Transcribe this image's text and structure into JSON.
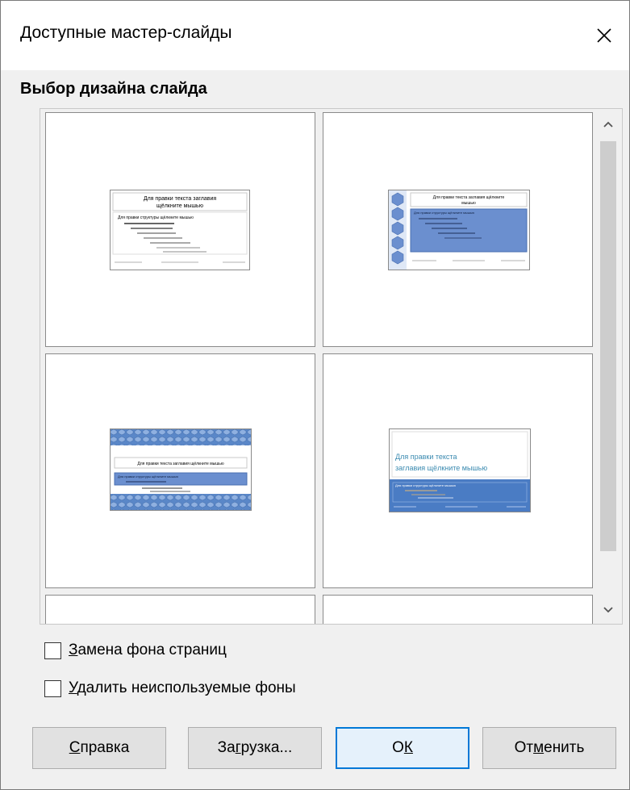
{
  "dialog": {
    "title": "Доступные мастер-слайды",
    "section_title": "Выбор дизайна слайда"
  },
  "slide_designs": [
    {
      "id": "design-1",
      "style": "white",
      "title_lines": [
        "Для правки текста заглавия",
        "щёлкните мышью"
      ],
      "body_text": "Для правки структуры щёлкните мышью",
      "colors": {
        "background": "#ffffff",
        "accent": "#dddddd"
      }
    },
    {
      "id": "design-2",
      "style": "blue-left-bubbles",
      "title_lines": [
        "Для правки текста заглавия щёлкните",
        "мышью"
      ],
      "body_text": "Для правки структуры щёлкните мышью",
      "colors": {
        "background": "#ffffff",
        "accent": "#6b8fcf"
      }
    },
    {
      "id": "design-3",
      "style": "blue-honeycomb-bands",
      "title_lines": [
        "Для правки текста заглавия щёлкните мышью"
      ],
      "body_text": "Для правки структуры щёлкните мышью",
      "colors": {
        "background": "#ffffff",
        "accent": "#5a87c8"
      }
    },
    {
      "id": "design-4",
      "style": "blue-bottom-half",
      "title_lines": [
        "Для правки текста",
        "заглавия щёлкните мышью"
      ],
      "body_text": "Для правки структуры щёлкните мышью",
      "colors": {
        "background": "#ffffff",
        "accent": "#4a7cc4",
        "title": "#3a8ab0"
      }
    }
  ],
  "options": {
    "replace_background_label_mnemonic": "З",
    "replace_background_label_rest": "амена фона страниц",
    "replace_background_checked": false,
    "delete_unused_label_mnemonic": "У",
    "delete_unused_label_rest": "далить неиспользуемые фоны",
    "delete_unused_checked": false
  },
  "buttons": {
    "help_mnemonic": "С",
    "help_rest": "правка",
    "load_before": "За",
    "load_mnemonic": "г",
    "load_rest": "рузка...",
    "ok_before": "О",
    "ok_mnemonic": "К",
    "cancel_before": "От",
    "cancel_mnemonic": "м",
    "cancel_rest": "енить"
  },
  "icons": {
    "close": "close-icon",
    "scroll_up": "chevron-up-icon",
    "scroll_down": "chevron-down-icon"
  }
}
